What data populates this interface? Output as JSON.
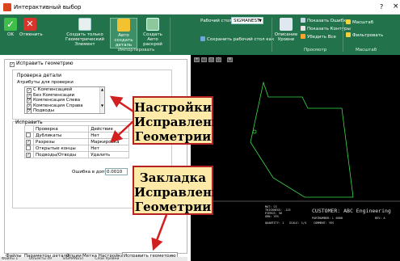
{
  "window": {
    "title": "Интерактивный выбор",
    "help": "?",
    "close": "×"
  },
  "ribbon": {
    "ok": "OK",
    "cancel": "Отменить",
    "create_geometric": "Создать только Геометрический Элемент",
    "auto_create_part": "Авто создать деталь",
    "create_auto_nest": "Создать Авто раскрой",
    "import_group": "Импортировать",
    "workspace_label": "Рабочий стол",
    "workspace_value": "SIGMANEST",
    "save_workspace": "Сохранить рабочий стол как",
    "description_levels": "Описание Уровне",
    "show_errors": "Показать Ошибки",
    "show_contours": "Показать Контуры",
    "remove_all": "Убедить Все",
    "view_group": "Просмотр",
    "scale": "Масштаб",
    "filter": "Фильтровать",
    "scale_group": "Масштаб"
  },
  "panel": {
    "fix_geometry": "Исправить геометрию",
    "part_check": "Проверка детали",
    "attributes_label": "Атрибуты для проверки",
    "attributes": [
      "С Компенсацией",
      "Без Компенсации",
      "Компенсация Слева",
      "Компенсация Справа",
      "Подводы"
    ],
    "fix_section": "Исправить",
    "table": {
      "col_check": "Проверка",
      "col_action": "Действие",
      "rows": [
        {
          "check": "Дубликаты",
          "action": "Нет",
          "checked": false
        },
        {
          "check": "Разрезы",
          "action": "Маркировка",
          "checked": true
        },
        {
          "check": "Открытые концы",
          "action": "Нет",
          "checked": false
        },
        {
          "check": "Подводы/Отводы",
          "action": "Удалить",
          "checked": true
        }
      ]
    },
    "tolerance_label": "Ошибка в допуске",
    "tolerance_value": "0.0010"
  },
  "tabs": [
    "Файлы",
    "Параметры детали",
    "Опции",
    "Метка Настройка",
    "Исправить геометрию"
  ],
  "status": {
    "files": "Файлы 1",
    "objects": "Объекты 49",
    "workspace": "SIGMANEST",
    "layers": "Слои Уровни"
  },
  "annotations": {
    "settings": "Настройки Исправления Геометрии",
    "tab": "Закладка Исправление Геометрии"
  },
  "cad": {
    "customer": "CUSTOMER: ABC Engineering",
    "lines": [
      "MAT: CS",
      "THICKNESS: .125",
      "PIERCE: 56",
      "GRN: YES",
      "QUANTITY: 1"
    ],
    "partnumber": "PARTNUMBER: L 6000",
    "scale": "SCALE: 1/4",
    "comment": "COMMENT: YES",
    "rev": "REV: A"
  },
  "colors": {
    "ribbon": "#22734b",
    "annotation_bg": "#fde9a8",
    "arrow": "#d21f1f",
    "cad_green": "#3cdc4a"
  }
}
